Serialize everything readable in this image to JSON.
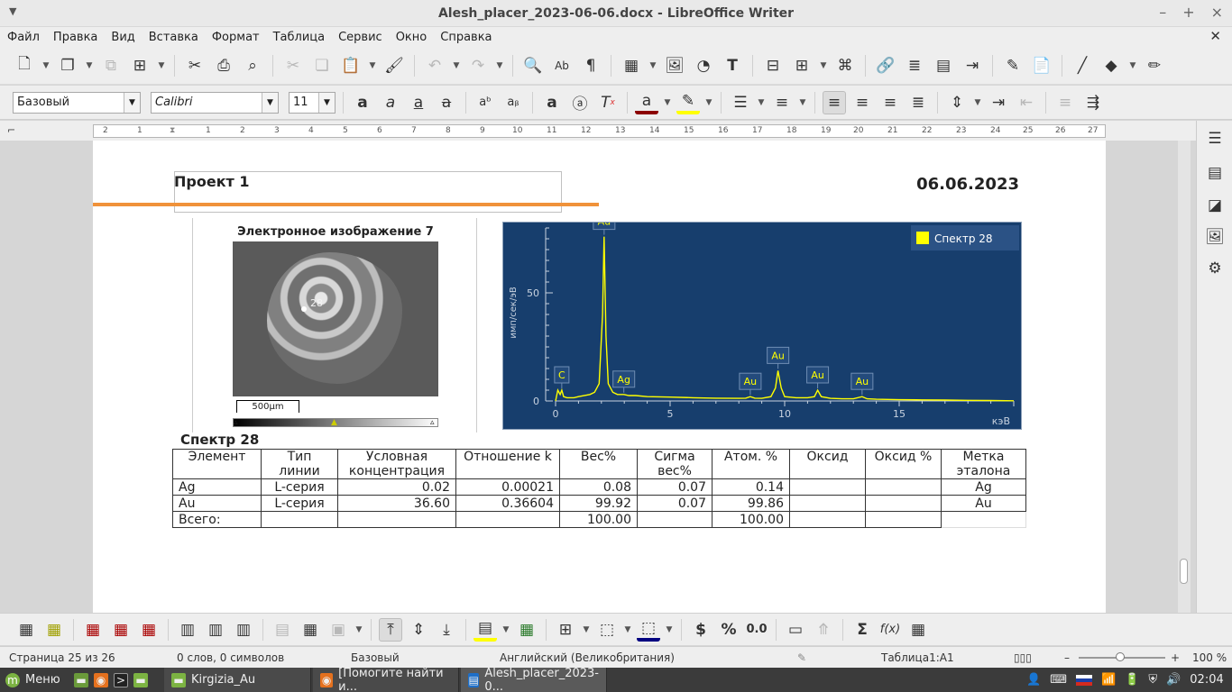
{
  "window": {
    "title": "Alesh_placer_2023-06-06.docx - LibreOffice Writer"
  },
  "menu": [
    "Файл",
    "Правка",
    "Вид",
    "Вставка",
    "Формат",
    "Таблица",
    "Сервис",
    "Окно",
    "Справка"
  ],
  "formatting": {
    "paragraph_style": "Базовый",
    "font_name": "Calibri",
    "font_size": "11"
  },
  "ruler": {
    "ticks": [
      "2",
      "1",
      "1",
      "2",
      "3",
      "4",
      "5",
      "6",
      "7",
      "8",
      "9",
      "10",
      "11",
      "12",
      "13",
      "14",
      "15",
      "16",
      "17",
      "18",
      "19",
      "20",
      "21",
      "22",
      "23",
      "24",
      "25",
      "26",
      "27"
    ]
  },
  "document": {
    "header_project": "Проект 1",
    "header_date": "06.06.2023",
    "image_title": "Электронное изображение 7",
    "image_spot_label": "28",
    "image_scale": "500µm",
    "table_title": "Спектр 28",
    "columns": [
      "Элемент",
      "Тип линии",
      "Условная концентрация",
      "Отношение k",
      "Вес%",
      "Сигма вес%",
      "Атом. %",
      "Оксид",
      "Оксид %",
      "Метка эталона"
    ],
    "rows": [
      [
        "Ag",
        "L-серия",
        "0.02",
        "0.00021",
        "0.08",
        "0.07",
        "0.14",
        "",
        "",
        "Ag"
      ],
      [
        "Au",
        "L-серия",
        "36.60",
        "0.36604",
        "99.92",
        "0.07",
        "99.86",
        "",
        "",
        "Au"
      ],
      [
        "Всего:",
        "",
        "",
        "",
        "100.00",
        "",
        "100.00",
        "",
        "",
        ""
      ]
    ]
  },
  "chart_data": {
    "type": "line",
    "title": "",
    "xlabel": "кэВ",
    "ylabel": "имп/сек/эВ",
    "xlim": [
      0,
      20
    ],
    "ylim": [
      0,
      80
    ],
    "xticks": [
      "0",
      "5",
      "10",
      "15"
    ],
    "yticks": [
      "0",
      "50"
    ],
    "legend": "top-right",
    "series": [
      {
        "name": "Спектр 28",
        "color": "#ffff00",
        "x": [
          0,
          0.1,
          0.2,
          0.27,
          0.35,
          0.5,
          0.8,
          1.0,
          1.5,
          1.7,
          1.9,
          2.05,
          2.12,
          2.2,
          2.3,
          2.5,
          2.7,
          2.98,
          3.2,
          3.5,
          4.0,
          5.0,
          6.0,
          7.0,
          8.0,
          8.3,
          8.5,
          8.7,
          9.0,
          9.4,
          9.6,
          9.71,
          9.85,
          10.0,
          10.5,
          11.0,
          11.3,
          11.44,
          11.6,
          12.0,
          12.5,
          13.0,
          13.38,
          13.6,
          14.0,
          15.0,
          16.0,
          17.0,
          18.0,
          19.0,
          20.0
        ],
        "y": [
          0,
          5,
          3,
          5,
          2,
          1.5,
          1.5,
          2,
          3,
          4,
          8,
          40,
          76,
          30,
          8,
          4,
          3,
          3,
          2.5,
          2.5,
          2,
          1.8,
          1.5,
          1.3,
          1.2,
          1.3,
          2,
          1.3,
          1.2,
          2,
          6,
          14,
          6,
          2,
          1.5,
          1.5,
          2,
          5,
          2,
          1.2,
          1,
          1,
          2,
          1,
          0.8,
          0.6,
          0.5,
          0.4,
          0.3,
          0.2,
          0.1
        ]
      }
    ],
    "annotations": [
      {
        "label": "C",
        "x": 0.27
      },
      {
        "label": "Au",
        "x": 2.12
      },
      {
        "label": "Ag",
        "x": 2.98
      },
      {
        "label": "Au",
        "x": 8.5
      },
      {
        "label": "Au",
        "x": 9.71
      },
      {
        "label": "Au",
        "x": 11.44
      },
      {
        "label": "Au",
        "x": 13.38
      }
    ]
  },
  "statusbar": {
    "page": "Страница 25 из 26",
    "words": "0 слов, 0 символов",
    "style": "Базовый",
    "language": "Английский (Великобритания)",
    "table_cell": "Таблица1:A1",
    "zoom": "100 %"
  },
  "taskbar": {
    "menu_label": "Меню",
    "windows": [
      "Kirgizia_Au",
      "[Помогите найти и...",
      "Alesh_placer_2023-0..."
    ],
    "time": "02:04"
  }
}
